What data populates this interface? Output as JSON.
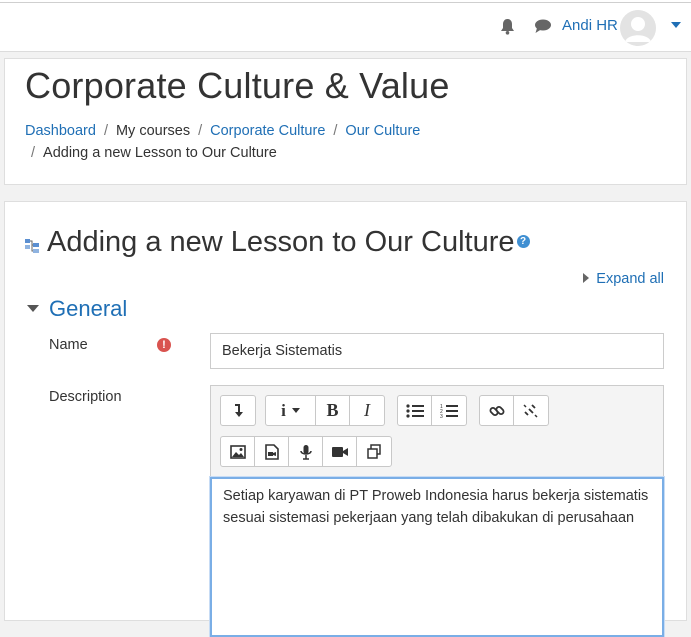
{
  "header": {
    "user_name": "Andi HR",
    "icons": [
      "bell-icon",
      "chat-icon",
      "avatar",
      "caret-down-icon"
    ]
  },
  "course": {
    "title": "Corporate Culture & Value",
    "breadcrumb": [
      {
        "label": "Dashboard",
        "link": true
      },
      {
        "label": "My courses",
        "link": false
      },
      {
        "label": "Corporate Culture",
        "link": true
      },
      {
        "label": "Our Culture",
        "link": true
      },
      {
        "label": "Adding a new Lesson to Our Culture",
        "link": false
      }
    ]
  },
  "form": {
    "heading": "Adding a new Lesson to Our Culture",
    "expand_all": "Expand all",
    "section_title": "General",
    "name_label": "Name",
    "name_value": "Bekerja Sistematis",
    "description_label": "Description",
    "description_value": "Setiap karyawan di PT Proweb Indonesia harus bekerja sistematis sesuai sistemasi pekerjaan yang telah dibakukan di perusahaan"
  },
  "colors": {
    "link": "#1f6fb5",
    "required": "#d9534f",
    "help": "#3f8fd2"
  }
}
